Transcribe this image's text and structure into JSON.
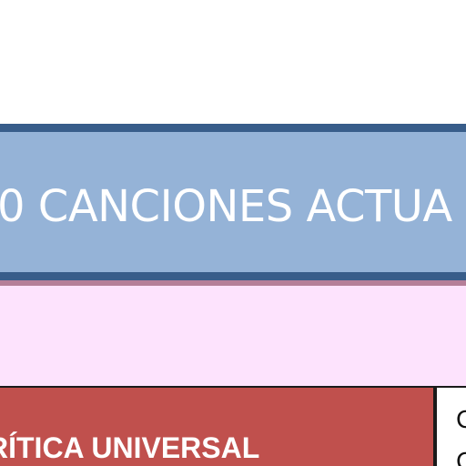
{
  "document": {
    "title": "0 CANCIONES ACTUA",
    "table": {
      "first_cell_text": "RÍTICA UNIVERSAL",
      "second_cell_text_top": "C",
      "second_cell_text_bottom": "C"
    }
  },
  "colors": {
    "banner_fill": "#95b3d7",
    "banner_border": "#385d8a",
    "pink_band": "#fde3fd",
    "table_red": "#c0504d"
  }
}
